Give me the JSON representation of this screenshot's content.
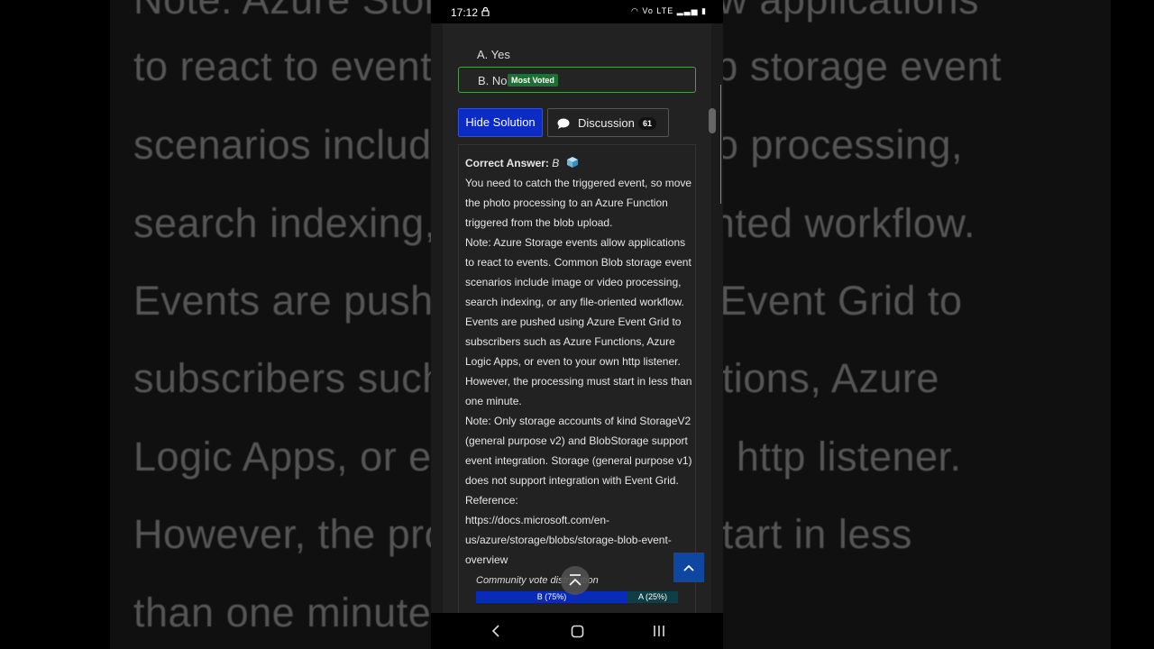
{
  "background": {
    "lines": [
      "Note: Azure Storage events allow applications",
      "to react to events. Common Blob storage event",
      "scenarios include image or video processing,",
      "search indexing, or any file-oriented workflow.",
      "Events are pushed using Azure Event Grid to",
      "subscribers such as Azure Functions, Azure",
      "Logic Apps, or even to your own http listener.",
      "However, the processing must start in less",
      "than one minute."
    ]
  },
  "status_bar": {
    "time": "17:12",
    "icons": "Vo LTE"
  },
  "choices": [
    {
      "label": "A. Yes"
    },
    {
      "label": "B. No",
      "badge": "Most Voted"
    }
  ],
  "buttons": {
    "hide_solution": "Hide Solution",
    "discussion": "Discussion",
    "discussion_count": "61"
  },
  "answer": {
    "correct_label": "Correct Answer:",
    "correct_value": "B",
    "paragraphs": [
      "You need to catch the triggered event, so move the photo processing to an Azure Function triggered from the blob upload.",
      "Note: Azure Storage events allow applications to react to events. Common Blob storage event scenarios include image or video processing, search indexing, or any file-oriented workflow. Events are pushed using Azure Event Grid to subscribers such as Azure Functions, Azure Logic Apps, or even to your own http listener. However, the processing must start in less than one minute.",
      "Note: Only storage accounts of kind StorageV2 (general purpose v2) and BlobStorage support event integration. Storage (general purpose v1) does not support integration with Event Grid.",
      "Reference:",
      "https://docs.microsoft.com/en-us/azure/storage/blobs/storage-blob-event-overview"
    ]
  },
  "vote": {
    "label": "Community vote distribution",
    "b_label": "B (75%)",
    "b_percent": 75,
    "a_label": "A (25%)",
    "a_percent": 25
  },
  "colors": {
    "accent": "#0b2cc4",
    "most_voted": "#1f6f35",
    "vote_b": "#0a2ab8",
    "vote_a": "#0f3f46"
  }
}
